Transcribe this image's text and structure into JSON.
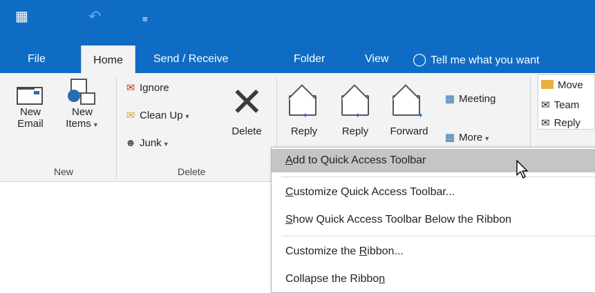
{
  "quick_access": {
    "app_icon": "outlook-folders-icon",
    "undo_icon": "undo-icon",
    "more_icon": "customize-dropdown-icon"
  },
  "tabs": [
    {
      "label": "File"
    },
    {
      "label": "Home"
    },
    {
      "label": "Send / Receive"
    },
    {
      "label": "Folder"
    },
    {
      "label": "View"
    }
  ],
  "tell_me": "Tell me what you want",
  "ribbon": {
    "new_group": {
      "label": "New",
      "new_email": [
        "New",
        "Email"
      ],
      "new_items": [
        "New",
        "Items"
      ]
    },
    "delete_group": {
      "label": "Delete",
      "ignore": "Ignore",
      "clean_up": "Clean Up",
      "junk": "Junk",
      "delete": "Delete"
    },
    "respond_group": {
      "reply": "Reply",
      "reply_all": "Reply",
      "forward": "Forward",
      "meeting": "Meeting",
      "more": "More"
    },
    "quick_steps": {
      "move": "Move",
      "team": "Team",
      "reply": "Reply"
    }
  },
  "context_menu": {
    "items": [
      {
        "pre": "",
        "u": "A",
        "post": "dd to Quick Access Toolbar"
      },
      {
        "pre": "",
        "u": "C",
        "post": "ustomize Quick Access Toolbar..."
      },
      {
        "pre": "",
        "u": "S",
        "post": "how Quick Access Toolbar Below the Ribbon"
      },
      {
        "pre": "Customize the ",
        "u": "R",
        "post": "ibbon..."
      },
      {
        "pre": "Collapse the Ribbo",
        "u": "n",
        "post": ""
      }
    ]
  },
  "colors": {
    "accent": "#0f6cc4",
    "ribbon_bg": "#f3f3f3",
    "menu_highlight": "#c5c5c5"
  }
}
